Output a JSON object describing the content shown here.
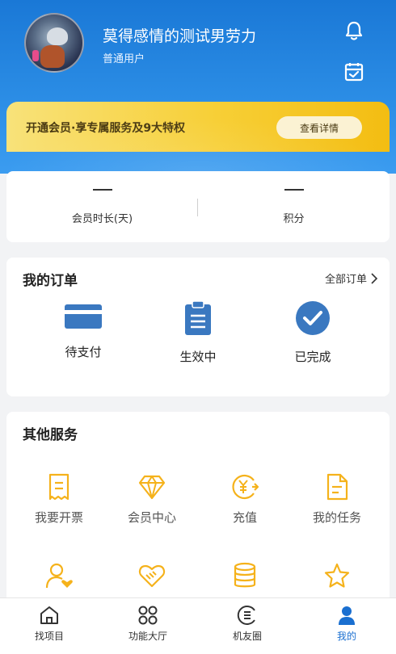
{
  "user": {
    "name": "莫得感情的测试男劳力",
    "type": "普通用户"
  },
  "vip": {
    "text": "开通会员·享专属服务及9大特权",
    "button_label": "查看详情"
  },
  "stats": [
    {
      "value": "—",
      "label": "会员时长(天)"
    },
    {
      "value": "—",
      "label": "积分"
    }
  ],
  "orders": {
    "title": "我的订单",
    "all_label": "全部订单",
    "items": [
      {
        "label": "待支付",
        "icon": "card-icon"
      },
      {
        "label": "生效中",
        "icon": "clipboard-icon"
      },
      {
        "label": "已完成",
        "icon": "check-circle-icon"
      }
    ]
  },
  "services": {
    "title": "其他服务",
    "items": [
      {
        "label": "我要开票",
        "icon": "receipt-icon"
      },
      {
        "label": "会员中心",
        "icon": "diamond-icon"
      },
      {
        "label": "充值",
        "icon": "yuan-icon"
      },
      {
        "label": "我的任务",
        "icon": "document-icon"
      },
      {
        "label": "",
        "icon": "user-heart-icon"
      },
      {
        "label": "",
        "icon": "handshake-icon"
      },
      {
        "label": "",
        "icon": "database-icon"
      },
      {
        "label": "",
        "icon": "star-icon"
      }
    ]
  },
  "tabs": [
    {
      "label": "找项目",
      "icon": "home-icon",
      "active": false
    },
    {
      "label": "功能大厅",
      "icon": "grid-icon",
      "active": false
    },
    {
      "label": "机友圈",
      "icon": "circle-e-icon",
      "active": false
    },
    {
      "label": "我的",
      "icon": "person-icon",
      "active": true
    }
  ],
  "colors": {
    "header_blue": "#1a78d6",
    "vip_gold": "#f7cf36",
    "accent_blue": "#3a78c0",
    "service_orange": "#f5b21b",
    "tab_active": "#1a6fd0"
  }
}
